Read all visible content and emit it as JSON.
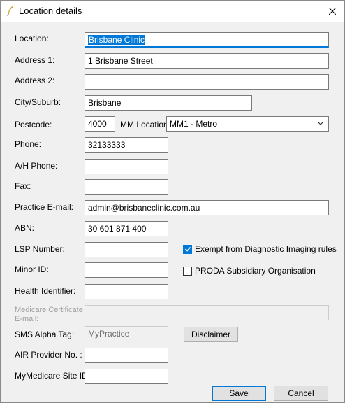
{
  "window": {
    "title": "Location details"
  },
  "fields": {
    "location": {
      "label": "Location:",
      "value": "Brisbane Clinic"
    },
    "address1": {
      "label": "Address 1:",
      "value": "1 Brisbane Street"
    },
    "address2": {
      "label": "Address 2:",
      "value": ""
    },
    "city": {
      "label": "City/Suburb:",
      "value": "Brisbane"
    },
    "postcode": {
      "label": "Postcode:",
      "value": "4000"
    },
    "mm_location": {
      "label": "MM Location:",
      "value": "MM1 - Metro"
    },
    "phone": {
      "label": "Phone:",
      "value": "32133333"
    },
    "ah_phone": {
      "label": "A/H Phone:",
      "value": ""
    },
    "fax": {
      "label": "Fax:",
      "value": ""
    },
    "practice_email": {
      "label": "Practice E-mail:",
      "value": "admin@brisbaneclinic.com.au"
    },
    "abn": {
      "label": "ABN:",
      "value": "30 601 871 400"
    },
    "lsp_number": {
      "label": "LSP Number:",
      "value": ""
    },
    "minor_id": {
      "label": "Minor ID:",
      "value": ""
    },
    "health_identifier": {
      "label": "Health Identifier:",
      "value": ""
    },
    "medicare_cert_email": {
      "label": "Medicare Certificate E-mail:",
      "value": ""
    },
    "sms_alpha_tag": {
      "label": "SMS Alpha Tag:",
      "value": "MyPractice"
    },
    "air_provider_no": {
      "label": "AIR Provider No. :",
      "value": ""
    },
    "mymedicare_site_id": {
      "label": "MyMedicare Site ID:",
      "value": ""
    }
  },
  "checkboxes": {
    "exempt_di": {
      "label": "Exempt from Diagnostic Imaging rules",
      "checked": true
    },
    "proda": {
      "label": "PRODA Subsidiary Organisation",
      "checked": false
    }
  },
  "buttons": {
    "disclaimer": "Disclaimer",
    "save": "Save",
    "cancel": "Cancel"
  },
  "colors": {
    "accent": "#0078d7",
    "window_bg": "#f0f0f0",
    "disabled_text": "#a0a0a0"
  },
  "icons": {
    "app": "feather-quill-icon",
    "close": "close-icon",
    "dropdown": "chevron-down-icon",
    "check": "checkmark-icon"
  }
}
